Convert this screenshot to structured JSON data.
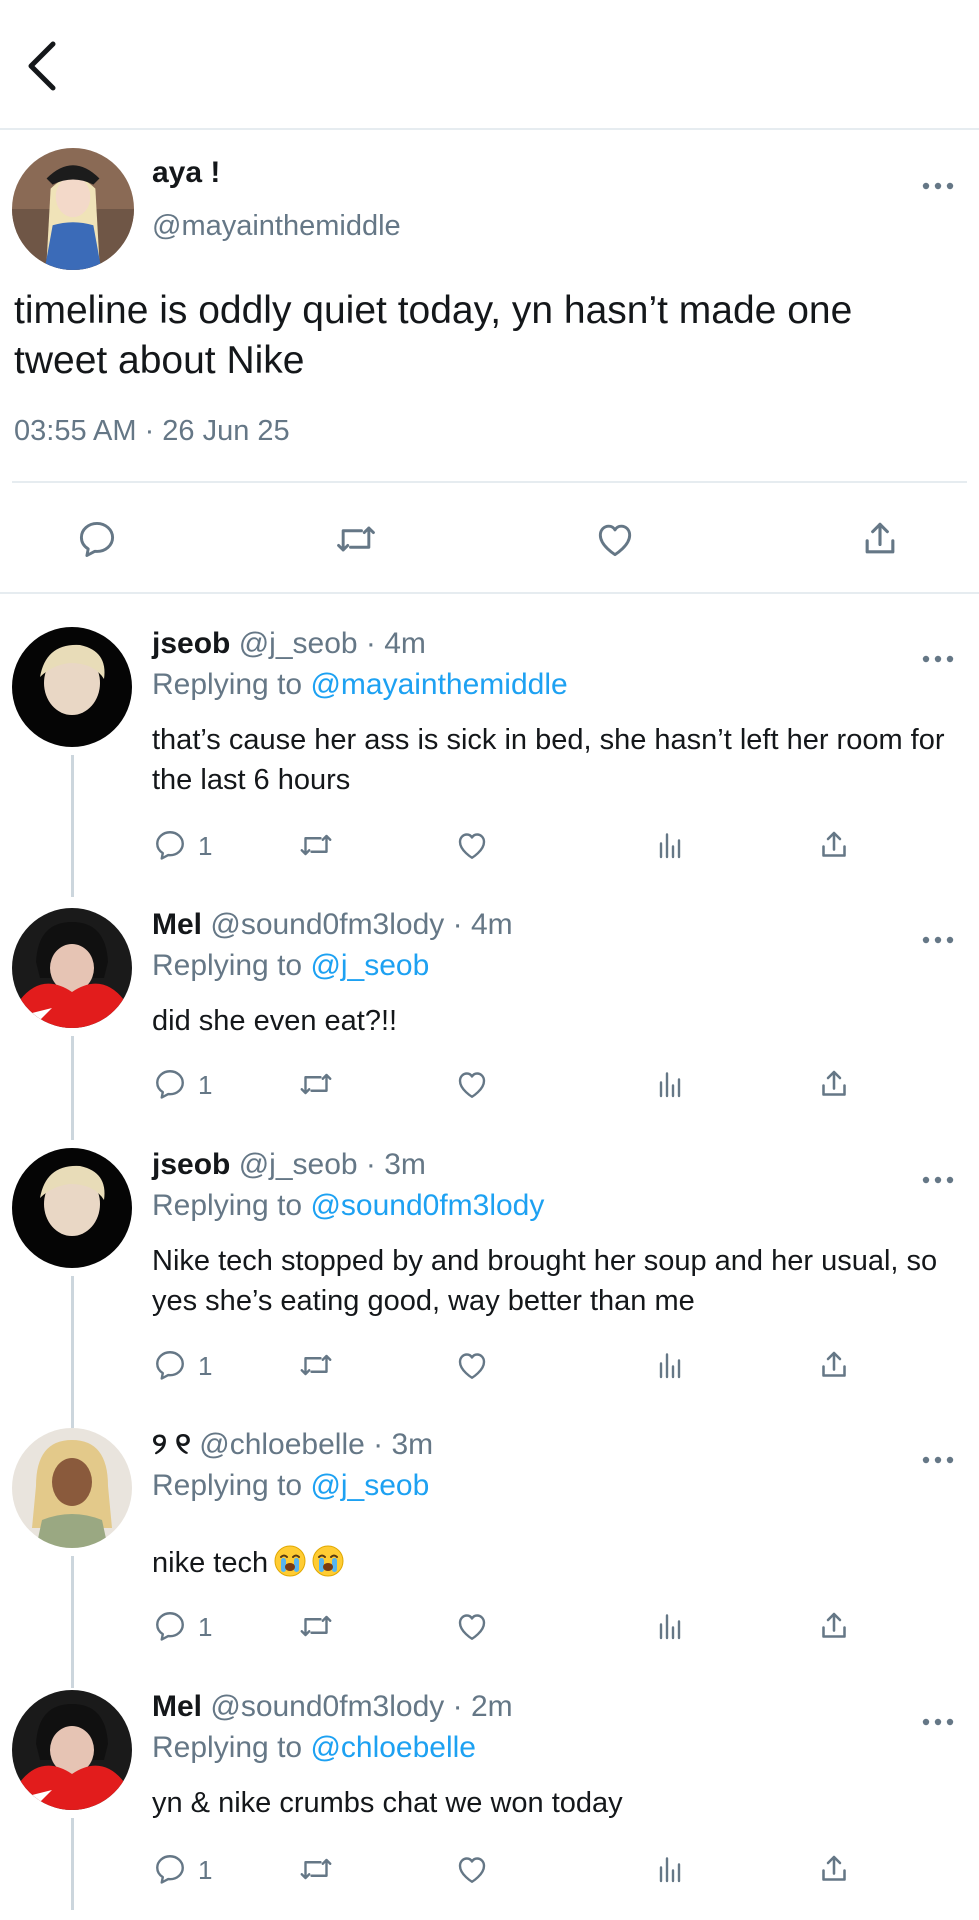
{
  "header": {
    "back_icon": "chevron-left-icon"
  },
  "tweet": {
    "name": "aya !",
    "handle": "@mayainthemiddle",
    "text": "timeline is oddly quiet today,  yn hasn’t made one tweet about Nike",
    "timestamp": "03:55 AM · 26 Jun 25",
    "actions": [
      "reply-icon",
      "retweet-icon",
      "like-icon",
      "share-icon"
    ]
  },
  "replies": [
    {
      "name": "jseob",
      "meta": "@j_seob · 4m",
      "replying_prefix": "Replying to ",
      "replying_to": "@mayainthemiddle",
      "text": "that’s cause her ass is sick in bed, she hasn’t left her room for the last 6 hours",
      "reply_count": "1"
    },
    {
      "name": "Mel",
      "meta": "@sound0fm3lody · 4m",
      "replying_prefix": "Replying to ",
      "replying_to": "@j_seob",
      "text": "did she even eat?!!",
      "reply_count": "1"
    },
    {
      "name": "jseob",
      "meta": "@j_seob · 3m",
      "replying_prefix": "Replying to ",
      "replying_to": "@sound0fm3lody",
      "text": "Nike tech stopped by and brought her soup and her usual, so yes she’s eating good, way better than me",
      "reply_count": "1"
    },
    {
      "name": "୨ ୧",
      "meta": "@chloebelle · 3m",
      "replying_prefix": "Replying to ",
      "replying_to": "@j_seob",
      "text": "nike tech",
      "text_emoji": [
        "loudly-crying-face",
        "loudly-crying-face"
      ],
      "reply_count": "1"
    },
    {
      "name": "Mel",
      "meta": "@sound0fm3lody · 2m",
      "replying_prefix": "Replying to ",
      "replying_to": "@chloebelle",
      "text": "yn & nike crumbs chat we won today",
      "reply_count": "1"
    }
  ],
  "colors": {
    "link": "#1da1f2",
    "muted": "#657786",
    "text": "#14171a",
    "divider": "#e6ecf0"
  }
}
